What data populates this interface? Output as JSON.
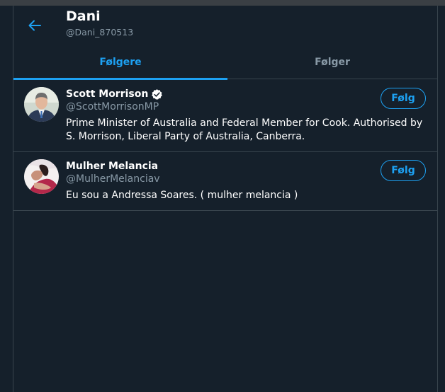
{
  "header": {
    "name": "Dani",
    "handle": "@Dani_870513"
  },
  "tabs": [
    {
      "label": "Følgere",
      "active": true
    },
    {
      "label": "Følger",
      "active": false
    }
  ],
  "users": [
    {
      "name": "Scott Morrison",
      "verified": true,
      "handle": "@ScottMorrisonMP",
      "bio": "Prime Minister of Australia and Federal Member for Cook. Authorised by S. Morrison, Liberal Party of Australia, Canberra.",
      "follow_label": "Følg"
    },
    {
      "name": "Mulher Melancia",
      "verified": false,
      "handle": "@MulherMelanciav",
      "bio": "Eu sou a Andressa Soares. ( mulher melancia )",
      "follow_label": "Følg"
    }
  ],
  "colors": {
    "background": "#15202b",
    "accent": "#1da1f2",
    "border": "#38444d",
    "secondary_text": "#8899a6"
  }
}
